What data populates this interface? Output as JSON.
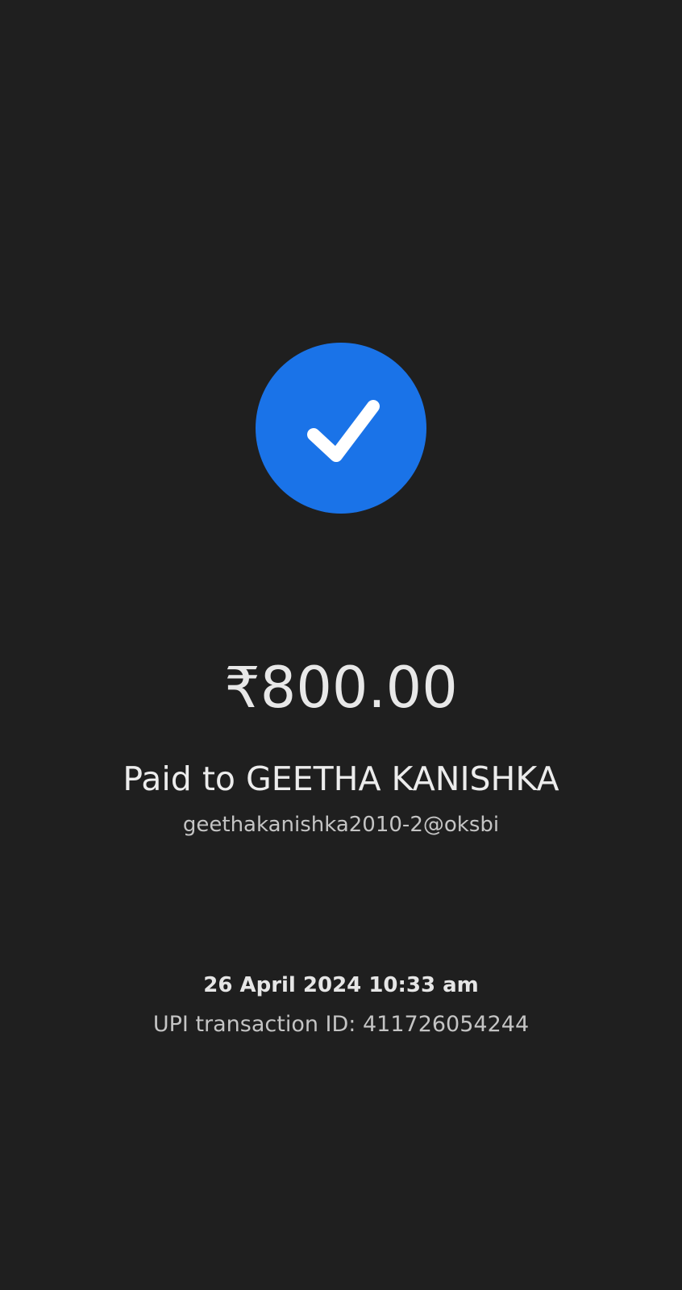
{
  "status": {
    "icon": "check-icon",
    "accent_color": "#1a73e8",
    "background_color": "#1f1f1f"
  },
  "payment": {
    "amount": "₹800.00",
    "paid_to": "Paid to GEETHA KANISHKA",
    "upi_id": "geethakanishka2010-2@oksbi",
    "datetime": "26 April 2024 10:33 am",
    "transaction_id": "UPI transaction ID: 411726054244"
  }
}
